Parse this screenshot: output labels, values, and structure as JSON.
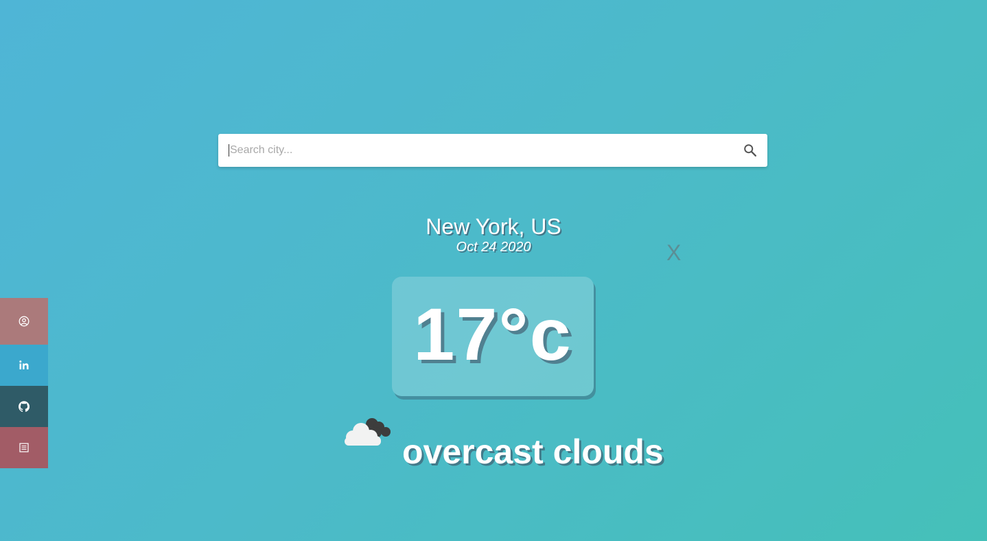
{
  "search": {
    "placeholder": "Search city...",
    "value": ""
  },
  "weather": {
    "location": "New York, US",
    "date": "Oct 24 2020",
    "temperature": "17°c",
    "description": "overcast clouds",
    "icon": "overcast-clouds-icon"
  },
  "close_label": "X",
  "social": [
    {
      "name": "profile",
      "icon": "user-circle-icon",
      "color": "#ab7a7b"
    },
    {
      "name": "linkedin",
      "icon": "linkedin-icon",
      "color": "#3ba8cd"
    },
    {
      "name": "github",
      "icon": "github-icon",
      "color": "#2f5b67"
    },
    {
      "name": "resume",
      "icon": "document-icon",
      "color": "#a25c66"
    }
  ],
  "colors": {
    "background_start": "#4fb5d6",
    "background_end": "#45c0b9"
  }
}
